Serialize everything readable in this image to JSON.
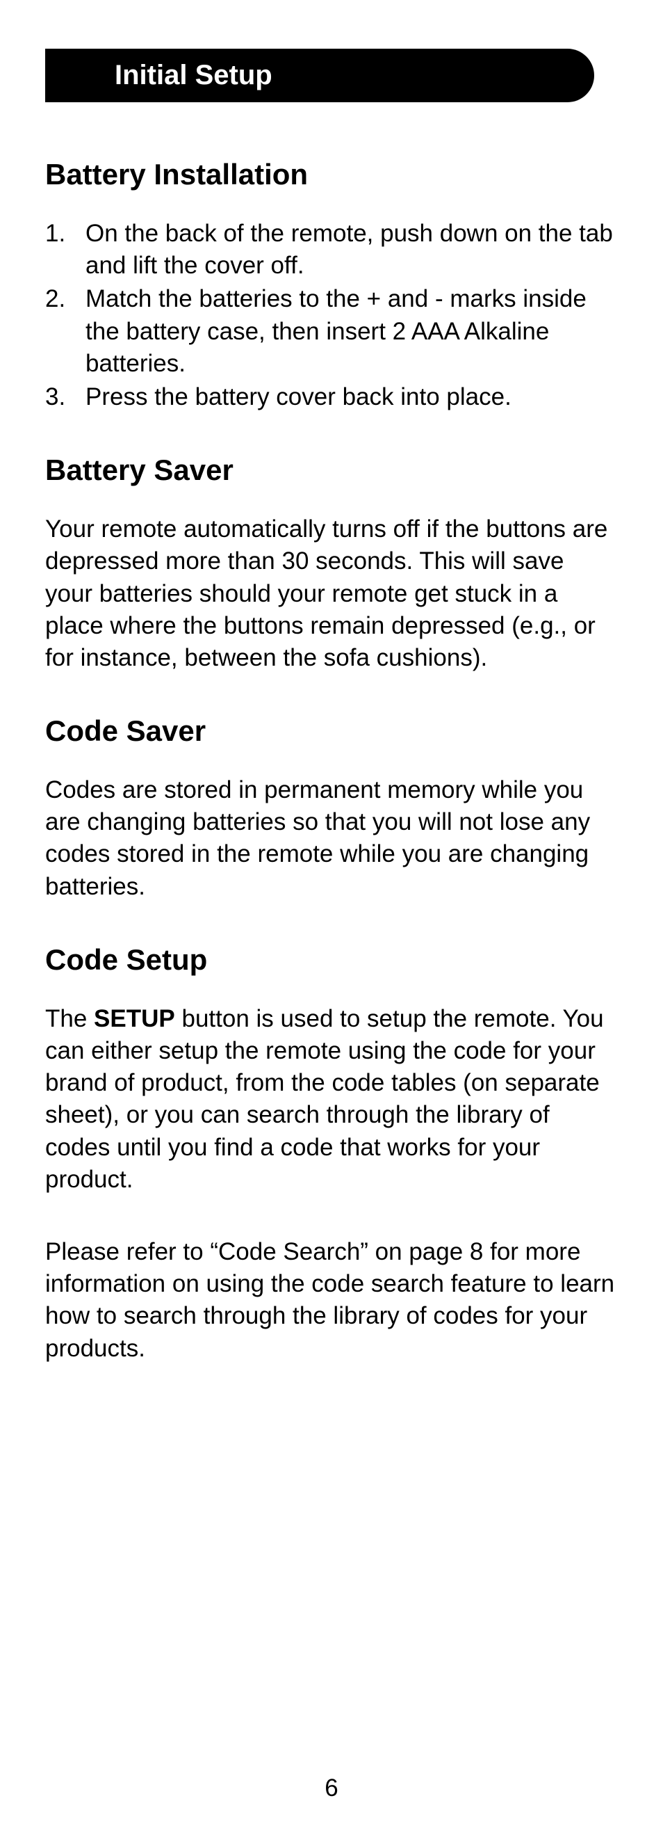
{
  "header": {
    "title": "Initial Setup"
  },
  "sections": {
    "battery_installation": {
      "heading": "Battery Installation",
      "steps": [
        "On the back of the remote, push down on the tab and lift the cover off.",
        "Match the batteries to the + and - marks inside the battery case, then insert 2 AAA Alkaline batteries.",
        "Press the battery cover back into place."
      ]
    },
    "battery_saver": {
      "heading": "Battery Saver",
      "body": "Your remote automatically turns off if the buttons are depressed more than 30 seconds. This will save your batteries should your remote get stuck in a place where the buttons remain depressed (e.g., or for instance, between the sofa cushions)."
    },
    "code_saver": {
      "heading": "Code Saver",
      "body": "Codes are stored in permanent memory while you are changing batteries so that you will not lose any codes stored in the remote while you are changing batteries."
    },
    "code_setup": {
      "heading": "Code Setup",
      "para1_pre": "The ",
      "para1_bold": "SETUP",
      "para1_post": " button is used to setup the remote. You can either setup the remote using the code for your brand of product, from the code tables (on separate sheet), or you can search through the library of codes until you find a code that works for your product.",
      "para2": "Please refer to “Code Search” on page 8 for more information on using the code search feature to learn how to search through the library of codes for your products."
    }
  },
  "page_number": "6"
}
